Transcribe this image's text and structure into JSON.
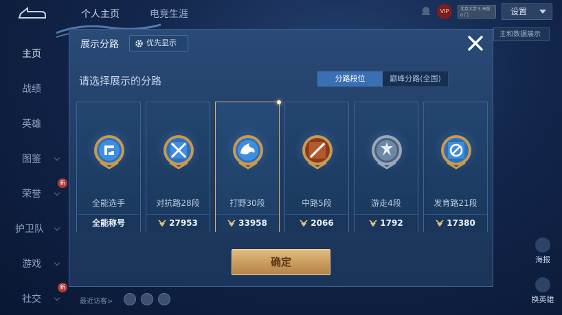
{
  "background": {
    "tabs": [
      "个人主页",
      "电竞生涯"
    ],
    "sidebar": [
      {
        "label": "主页",
        "active": true
      },
      {
        "label": "战绩"
      },
      {
        "label": "英雄"
      },
      {
        "label": "图鉴"
      },
      {
        "label": "荣誉"
      },
      {
        "label": "护卫队"
      },
      {
        "label": "游戏"
      },
      {
        "label": "社交"
      }
    ],
    "settings_label": "设置",
    "side_button_label": "主和数据展示",
    "vip_label": "VIP",
    "status_text": "北京大学 5 天前 0 门",
    "right_icons": [
      {
        "label": "海报"
      },
      {
        "label": "换英雄"
      }
    ],
    "recent_visitors_label": "最近访客>",
    "new_badge": "新"
  },
  "modal": {
    "title": "展示分路",
    "priority_label": "优先显示",
    "subtitle": "请选择展示的分路",
    "tabs": [
      {
        "label": "分路段位",
        "active": true
      },
      {
        "label": "巅峰分路(全国)",
        "active": false
      }
    ],
    "cards": [
      {
        "label": "全能选手",
        "value": "全能称号",
        "has_chevron": false,
        "icon": "all-round-badge-icon",
        "selected": false
      },
      {
        "label": "对抗路28段",
        "value": "27953",
        "has_chevron": true,
        "icon": "clash-lane-badge-icon",
        "selected": false
      },
      {
        "label": "打野30段",
        "value": "33958",
        "has_chevron": true,
        "icon": "jungle-badge-icon",
        "selected": true
      },
      {
        "label": "中路5段",
        "value": "2066",
        "has_chevron": true,
        "icon": "mid-lane-badge-icon",
        "selected": false
      },
      {
        "label": "游走4段",
        "value": "1792",
        "has_chevron": true,
        "icon": "roam-badge-icon",
        "selected": false
      },
      {
        "label": "发育路21段",
        "value": "17380",
        "has_chevron": true,
        "icon": "farm-lane-badge-icon",
        "selected": false
      }
    ],
    "confirm_label": "确定",
    "colors": {
      "accent_blue": "#3a6fb4",
      "gold": "#d9b27a",
      "confirm_gold": "#c89b5a"
    }
  }
}
